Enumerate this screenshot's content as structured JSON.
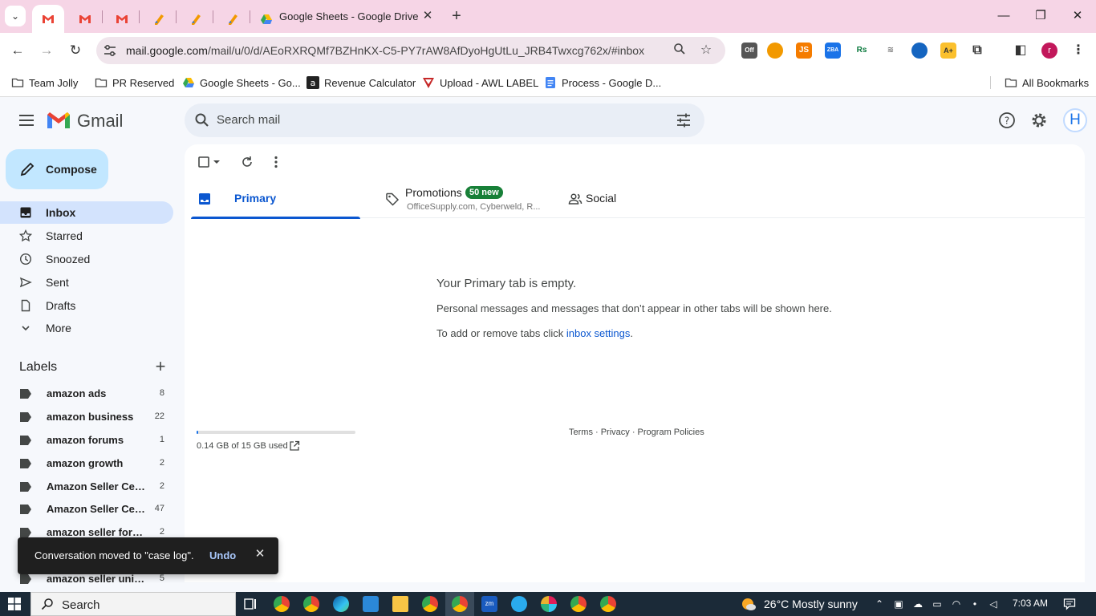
{
  "browser": {
    "active_tab_title": "Google Sheets - Google Drive",
    "url_host": "mail.google.com",
    "url_path": "/mail/u/0/d/AEoRXRQMf7BZHnKX-C5-PY7rAW8AfDyoHgUtLu_JRB4Twxcg762x/#inbox",
    "profile_initial": "r",
    "bookmarks": [
      {
        "label": "Team Jolly"
      },
      {
        "label": "PR Reserved"
      },
      {
        "label": "Google Sheets - Go..."
      },
      {
        "label": "Revenue Calculator"
      },
      {
        "label": "Upload - AWL LABEL"
      },
      {
        "label": "Process - Google D..."
      }
    ],
    "all_bookmarks": "All Bookmarks"
  },
  "gmail": {
    "logo_text": "Gmail",
    "search_placeholder": "Search mail",
    "avatar_initial": "H",
    "compose": "Compose",
    "nav": [
      {
        "label": "Inbox",
        "icon": "inbox-icon"
      },
      {
        "label": "Starred",
        "icon": "star-icon"
      },
      {
        "label": "Snoozed",
        "icon": "clock-icon"
      },
      {
        "label": "Sent",
        "icon": "send-icon"
      },
      {
        "label": "Drafts",
        "icon": "draft-icon"
      },
      {
        "label": "More",
        "icon": "chevron-down-icon"
      }
    ],
    "labels_title": "Labels",
    "labels": [
      {
        "name": "amazon ads",
        "count": "8"
      },
      {
        "name": "amazon business",
        "count": "22"
      },
      {
        "name": "amazon forums",
        "count": "1"
      },
      {
        "name": "amazon growth",
        "count": "2"
      },
      {
        "name": "Amazon Seller Central",
        "count": "2"
      },
      {
        "name": "Amazon Seller Central",
        "count": "47"
      },
      {
        "name": "amazon seller forums",
        "count": "2"
      },
      {
        "name": "",
        "count": ""
      },
      {
        "name": "amazon seller university",
        "count": "5"
      }
    ],
    "tabs": {
      "primary": "Primary",
      "promotions": "Promotions",
      "promotions_badge": "50 new",
      "promotions_sub": "OfficeSupply.com, Cyberweld, R...",
      "social": "Social"
    },
    "empty": {
      "title": "Your Primary tab is empty.",
      "desc": "Personal messages and messages that don’t appear in other tabs will be shown here.",
      "add_prefix": "To add or remove tabs click ",
      "add_link": "inbox settings",
      "add_suffix": "."
    },
    "storage": {
      "text": "0.14 GB of 15 GB used",
      "fraction": 0.0093
    },
    "footer": "Terms · Privacy · Program Policies",
    "snackbar": {
      "message": "Conversation moved to \"case log\".",
      "action": "Undo"
    }
  },
  "taskbar": {
    "search": "Search",
    "weather": "26°C  Mostly sunny",
    "time": "7:03 AM"
  },
  "colors": {
    "tabstrip": "#f6d5e6",
    "compose": "#c2e7ff",
    "active_nav": "#d3e3fd",
    "primary_accent": "#0b57d0",
    "badge_green": "#188038"
  }
}
